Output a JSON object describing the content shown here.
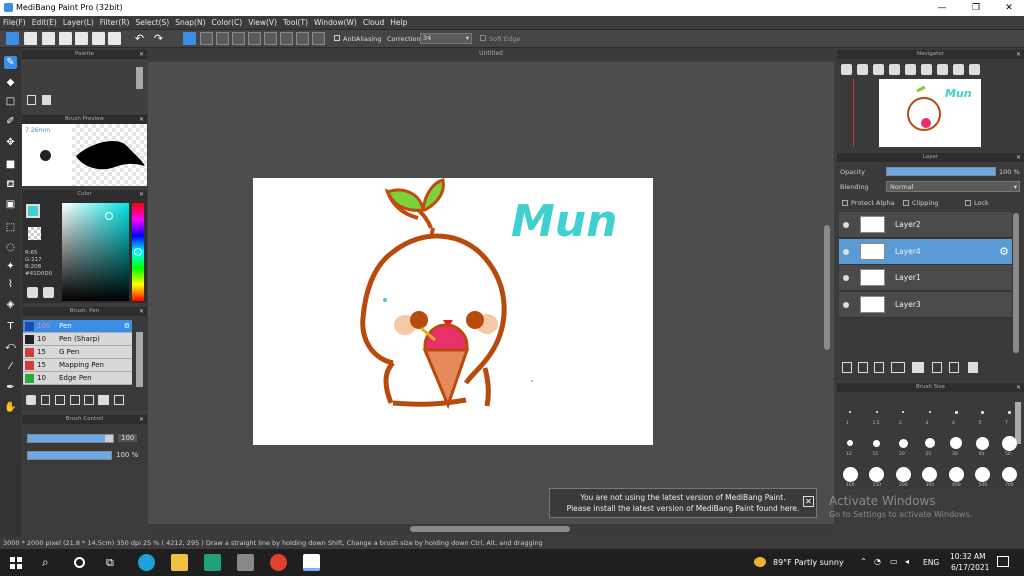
{
  "window": {
    "title": "MediBang Paint Pro (32bit)",
    "minimize": "—",
    "maximize": "❐",
    "close": "✕"
  },
  "menu": [
    "File(F)",
    "Edit(E)",
    "Layer(L)",
    "Filter(R)",
    "Select(S)",
    "Snap(N)",
    "Color(C)",
    "View(V)",
    "Tool(T)",
    "Window(W)",
    "Cloud",
    "Help"
  ],
  "toolbar": {
    "antialiasing": "AntiAliasing",
    "correction_label": "Correction",
    "correction_value": "34",
    "soft_edge": "Soft Edge"
  },
  "panels": {
    "palette": "Palette",
    "brush_preview": "Brush Preview",
    "brush_preview_size": "7.26mm",
    "color": "Color",
    "brush_pen": "Brush: Pen",
    "brush_control": "Brush Control",
    "navigator": "Navigator",
    "layer": "Layer",
    "brush_size": "Brush Size"
  },
  "color_values": {
    "r": "R:65",
    "g": "G:217",
    "b": "B:208",
    "hex": "#41D0D0",
    "fg": "#41D0D0",
    "bg": "#ffffff"
  },
  "brushes": [
    {
      "size": "100",
      "name": "Pen",
      "color": "#1c4fb0",
      "selected": true
    },
    {
      "size": "10",
      "name": "Pen (Sharp)",
      "color": "#222222",
      "selected": false
    },
    {
      "size": "15",
      "name": "G Pen",
      "color": "#d43b3b",
      "selected": false
    },
    {
      "size": "15",
      "name": "Mapping Pen",
      "color": "#d43b3b",
      "selected": false
    },
    {
      "size": "10",
      "name": "Edge Pen",
      "color": "#2fa83a",
      "selected": false
    }
  ],
  "brush_control": {
    "size_value": "100",
    "opacity_value": "100 %",
    "size_level": 0.9,
    "opacity_level": 1.0
  },
  "document": {
    "tab": "Untitled"
  },
  "drawing_text": "Mun",
  "layer_panel": {
    "opacity_label": "Opacity",
    "opacity_value": "100 %",
    "opacity_level": 1.0,
    "blending_label": "Blending",
    "blending_value": "Normal",
    "protect_alpha": "Protect Alpha",
    "clipping": "Clipping",
    "lock": "Lock",
    "layers": [
      {
        "name": "Layer2",
        "selected": false
      },
      {
        "name": "Layer4",
        "selected": true
      },
      {
        "name": "Layer1",
        "selected": false
      },
      {
        "name": "Layer3",
        "selected": false
      }
    ]
  },
  "brush_sizes": {
    "row1": [
      "1",
      "1.5",
      "2",
      "3",
      "4",
      "5",
      "7"
    ],
    "row2": [
      "12",
      "15",
      "20",
      "25",
      "30",
      "40",
      "50"
    ],
    "row3": [
      "100",
      "150",
      "200",
      "300",
      "400",
      "500",
      "700"
    ]
  },
  "notification": {
    "line1": "You are not using the latest version of MediBang Paint.",
    "line2": "Please install the latest version of MediBang Paint found here."
  },
  "watermark": {
    "line1": "Activate Windows",
    "line2": "Go to Settings to activate Windows."
  },
  "status": "3000 * 2000 pixel  (21.8 * 14.5cm)  350 dpi  25 %  ( 4212, 295 )  Draw a straight line by holding down Shift, Change a brush size by holding down Ctrl, Alt, and dragging",
  "taskbar": {
    "weather": "89°F  Partly sunny",
    "lang": "ENG",
    "time": "10:32 AM",
    "date": "6/17/2021"
  }
}
